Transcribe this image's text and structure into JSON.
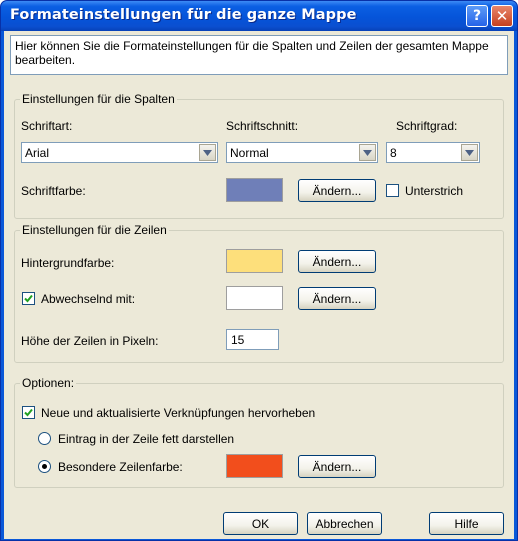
{
  "window": {
    "title": "Formateinstellungen für die ganze Mappe",
    "help_glyph": "?",
    "close_glyph": "✕"
  },
  "description": "Hier können Sie die Formateinstellungen für die Spalten und Zeilen der gesamten Mappe bearbeiten.",
  "columns": {
    "legend": "Einstellungen für die Spalten",
    "font_label": "Schriftart:",
    "font_value": "Arial",
    "style_label": "Schriftschnitt:",
    "style_value": "Normal",
    "size_label": "Schriftgrad:",
    "size_value": "8",
    "color_label": "Schriftfarbe:",
    "font_color": "#6f7fb8",
    "change_label": "Ändern...",
    "underline_label": "Unterstrich",
    "underline_checked": false
  },
  "rows": {
    "legend": "Einstellungen für die Zeilen",
    "bg_label": "Hintergrundfarbe:",
    "bg_color": "#fddf7b",
    "change_label_1": "Ändern...",
    "alternate_label": "Abwechselnd mit:",
    "alternate_checked": true,
    "alternate_color": "#ffffff",
    "change_label_2": "Ändern...",
    "height_label": "Höhe der Zeilen in Pixeln:",
    "height_value": "15"
  },
  "options": {
    "legend": "Optionen:",
    "highlight_label": "Neue und aktualisierte Verknüpfungen hervorheben",
    "highlight_checked": true,
    "bold_label": "Eintrag in der Zeile fett darstellen",
    "bold_selected": false,
    "special_label": "Besondere Zeilenfarbe:",
    "special_selected": true,
    "special_color": "#f24e1c",
    "change_label": "Ändern..."
  },
  "footer": {
    "ok_label": "OK",
    "cancel_label": "Abbrechen",
    "help_label": "Hilfe"
  }
}
